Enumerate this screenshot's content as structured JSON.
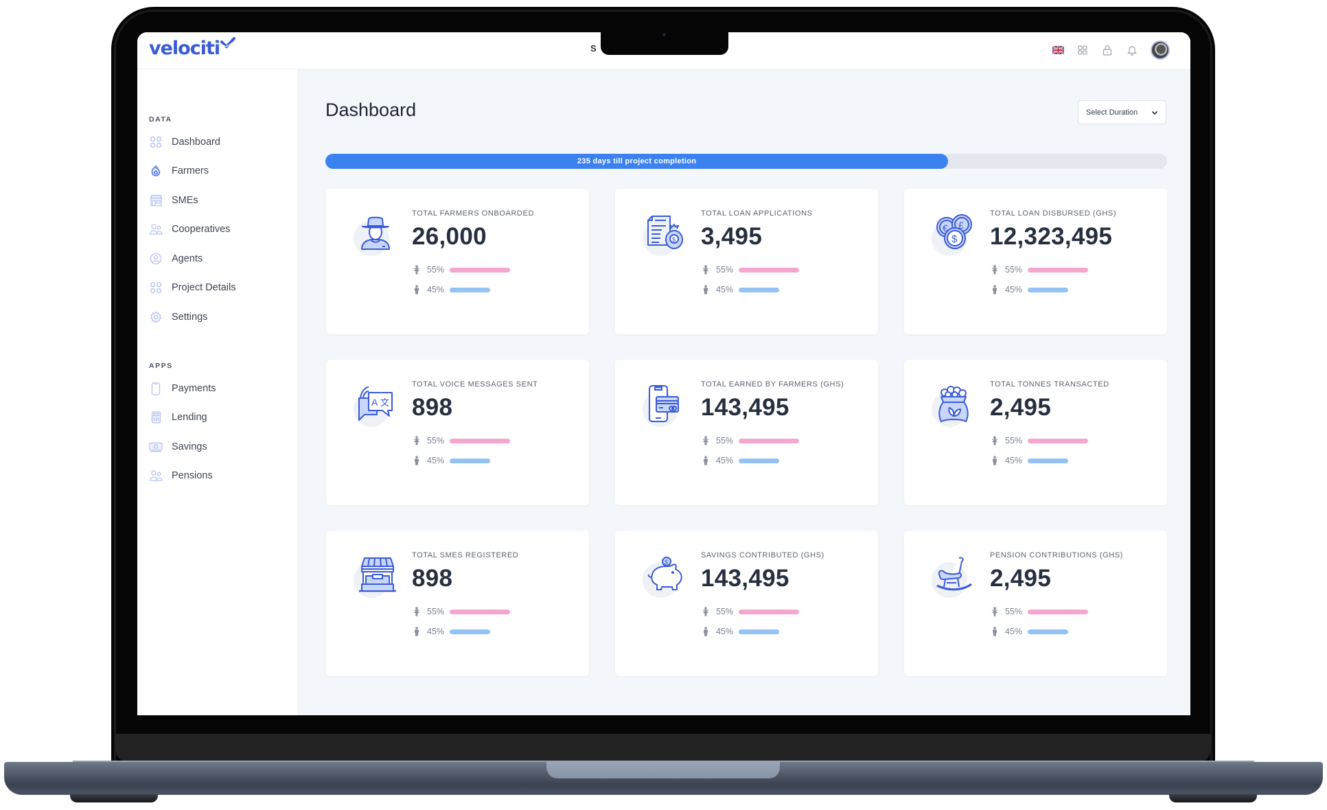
{
  "app": {
    "brand": "velociti",
    "top_title_partial": "S",
    "language_flag": "UK flag"
  },
  "colors": {
    "brand": "#3a5bd6",
    "primary": "#3b82f0",
    "female_bar": "#f4a6cf",
    "male_bar": "#93c2f5",
    "icon_stroke": "#3a5bd6",
    "icon_fill": "#c9d6fb"
  },
  "header": {
    "icons": [
      "uk-flag-icon",
      "apps-grid-icon",
      "lock-icon",
      "bell-icon",
      "user-avatar"
    ]
  },
  "sidebar": {
    "sections": [
      {
        "label": "DATA",
        "items": [
          {
            "label": "Dashboard",
            "icon": "dashboard-grid-icon"
          },
          {
            "label": "Farmers",
            "icon": "farmers-icon"
          },
          {
            "label": "SMEs",
            "icon": "store-icon"
          },
          {
            "label": "Cooperatives",
            "icon": "users-group-icon"
          },
          {
            "label": "Agents",
            "icon": "user-circle-icon"
          },
          {
            "label": "Project Details",
            "icon": "grid-icon"
          },
          {
            "label": "Settings",
            "icon": "gear-icon"
          }
        ]
      },
      {
        "label": "APPS",
        "items": [
          {
            "label": "Payments",
            "icon": "mobile-phone-icon"
          },
          {
            "label": "Lending",
            "icon": "calculator-icon"
          },
          {
            "label": "Savings",
            "icon": "cash-icon"
          },
          {
            "label": "Pensions",
            "icon": "users-group-icon"
          }
        ]
      }
    ]
  },
  "main": {
    "title": "Dashboard",
    "duration_select": {
      "label": "Select Duration",
      "icon": "chevron-down-icon"
    },
    "progress": {
      "label": "235 days till project completion",
      "fraction_complete": 0.74
    }
  },
  "cards": [
    {
      "title": "TOTAL FARMERS ONBOARDED",
      "value": "26,000",
      "icon": "farmer-icon",
      "female": {
        "pct_label": "55%",
        "pct": 55
      },
      "male": {
        "pct_label": "45%",
        "pct": 45
      }
    },
    {
      "title": "TOTAL LOAN APPLICATIONS",
      "value": "3,495",
      "icon": "loan-document-icon",
      "female": {
        "pct_label": "55%",
        "pct": 55
      },
      "male": {
        "pct_label": "45%",
        "pct": 45
      }
    },
    {
      "title": "TOTAL LOAN DISBURSED (GHS)",
      "value": "12,323,495",
      "icon": "coins-icon",
      "female": {
        "pct_label": "55%",
        "pct": 55
      },
      "male": {
        "pct_label": "45%",
        "pct": 45
      }
    },
    {
      "title": "TOTAL VOICE MESSAGES SENT",
      "value": "898",
      "icon": "translate-chat-icon",
      "female": {
        "pct_label": "55%",
        "pct": 55
      },
      "male": {
        "pct_label": "45%",
        "pct": 45
      }
    },
    {
      "title": "TOTAL EARNED BY FARMERS (GHS)",
      "value": "143,495",
      "icon": "mobile-payment-icon",
      "female": {
        "pct_label": "55%",
        "pct": 55
      },
      "male": {
        "pct_label": "45%",
        "pct": 45
      }
    },
    {
      "title": "TOTAL TONNES TRANSACTED",
      "value": "2,495",
      "icon": "grain-sack-icon",
      "female": {
        "pct_label": "55%",
        "pct": 55
      },
      "male": {
        "pct_label": "45%",
        "pct": 45
      }
    },
    {
      "title": "TOTAL SMES REGISTERED",
      "value": "898",
      "icon": "market-stall-icon",
      "female": {
        "pct_label": "55%",
        "pct": 55
      },
      "male": {
        "pct_label": "45%",
        "pct": 45
      }
    },
    {
      "title": "SAVINGS CONTRIBUTED (GHS)",
      "value": "143,495",
      "icon": "piggy-bank-icon",
      "female": {
        "pct_label": "55%",
        "pct": 55
      },
      "male": {
        "pct_label": "45%",
        "pct": 45
      }
    },
    {
      "title": "PENSION CONTRIBUTIONS (GHS)",
      "value": "2,495",
      "icon": "rocking-chair-icon",
      "female": {
        "pct_label": "55%",
        "pct": 55
      },
      "male": {
        "pct_label": "45%",
        "pct": 45
      }
    }
  ]
}
